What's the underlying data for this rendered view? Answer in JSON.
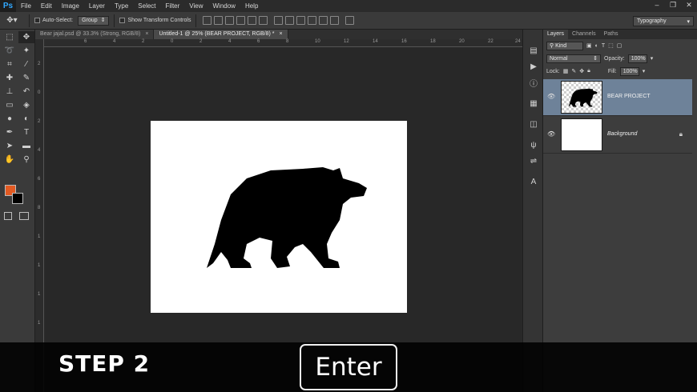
{
  "app": {
    "logo": "Ps"
  },
  "menu": [
    "File",
    "Edit",
    "Image",
    "Layer",
    "Type",
    "Select",
    "Filter",
    "View",
    "Window",
    "Help"
  ],
  "window_controls": [
    "–",
    "❐",
    "✕"
  ],
  "options_bar": {
    "tool_icon": "move-tool-icon",
    "auto_select_label": "Auto-Select:",
    "auto_select_value": "Group",
    "show_transform_label": "Show Transform Controls",
    "workspace": "Typography"
  },
  "tabs": [
    {
      "label": "Bear jajal.psd @ 33.3% (Strong, RGB/8)",
      "close": "×",
      "active": false
    },
    {
      "label": "Untitled-1 @ 25% (BEAR PROJECT, RGB/8) *",
      "close": "×",
      "active": true
    }
  ],
  "ruler_top_labels": [
    "6",
    "4",
    "2",
    "0",
    "2",
    "4",
    "6",
    "8",
    "10",
    "12",
    "14",
    "16",
    "18",
    "20",
    "22",
    "24"
  ],
  "ruler_left_labels": [
    "2",
    "0",
    "2",
    "4",
    "6",
    "8",
    "1",
    "1",
    "1",
    "1"
  ],
  "layers_panel": {
    "tabs": [
      "Layers",
      "Channels",
      "Paths"
    ],
    "filter_kind": "Kind",
    "blend_mode": "Normal",
    "opacity_label": "Opacity:",
    "opacity_value": "100%",
    "lock_label": "Lock:",
    "fill_label": "Fill:",
    "fill_value": "100%",
    "layers": [
      {
        "name": "BEAR PROJECT",
        "selected": true
      },
      {
        "name": "Background",
        "selected": false
      }
    ]
  },
  "overlay": {
    "step": "STEP 2",
    "key": "Enter"
  },
  "colors": {
    "foreground": "#e35a22",
    "background": "#000000",
    "selected_layer": "#6e8299",
    "ps_blue": "#31a8ff"
  }
}
